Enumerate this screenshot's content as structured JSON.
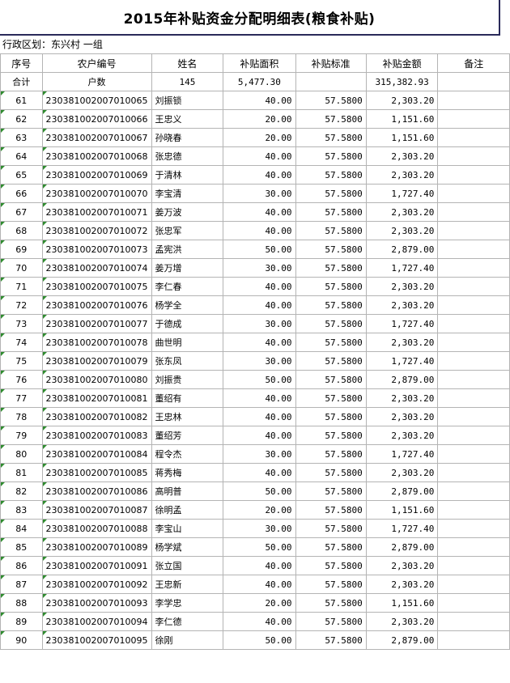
{
  "title": "2015年补贴资金分配明细表(粮食补贴)",
  "region_label": "行政区划：东兴村 一组",
  "headers": [
    "序号",
    "农户编号",
    "姓名",
    "补贴面积",
    "补贴标准",
    "补贴金额",
    "备注"
  ],
  "summary": {
    "label": "合计",
    "count_label": "户数",
    "count": "145",
    "area": "5,477.30",
    "standard": "",
    "amount": "315,382.93",
    "note": ""
  },
  "rows": [
    {
      "no": "61",
      "id": "230381002007010065",
      "name": "刘振锁",
      "area": "40.00",
      "std": "57.5800",
      "amt": "2,303.20"
    },
    {
      "no": "62",
      "id": "230381002007010066",
      "name": "王忠义",
      "area": "20.00",
      "std": "57.5800",
      "amt": "1,151.60"
    },
    {
      "no": "63",
      "id": "230381002007010067",
      "name": "孙晓春",
      "area": "20.00",
      "std": "57.5800",
      "amt": "1,151.60"
    },
    {
      "no": "64",
      "id": "230381002007010068",
      "name": "张忠德",
      "area": "40.00",
      "std": "57.5800",
      "amt": "2,303.20"
    },
    {
      "no": "65",
      "id": "230381002007010069",
      "name": "于清林",
      "area": "40.00",
      "std": "57.5800",
      "amt": "2,303.20"
    },
    {
      "no": "66",
      "id": "230381002007010070",
      "name": "李宝清",
      "area": "30.00",
      "std": "57.5800",
      "amt": "1,727.40"
    },
    {
      "no": "67",
      "id": "230381002007010071",
      "name": "姜万波",
      "area": "40.00",
      "std": "57.5800",
      "amt": "2,303.20"
    },
    {
      "no": "68",
      "id": "230381002007010072",
      "name": "张忠军",
      "area": "40.00",
      "std": "57.5800",
      "amt": "2,303.20"
    },
    {
      "no": "69",
      "id": "230381002007010073",
      "name": "孟宪洪",
      "area": "50.00",
      "std": "57.5800",
      "amt": "2,879.00"
    },
    {
      "no": "70",
      "id": "230381002007010074",
      "name": "姜万增",
      "area": "30.00",
      "std": "57.5800",
      "amt": "1,727.40"
    },
    {
      "no": "71",
      "id": "230381002007010075",
      "name": "李仁春",
      "area": "40.00",
      "std": "57.5800",
      "amt": "2,303.20"
    },
    {
      "no": "72",
      "id": "230381002007010076",
      "name": "杨学全",
      "area": "40.00",
      "std": "57.5800",
      "amt": "2,303.20"
    },
    {
      "no": "73",
      "id": "230381002007010077",
      "name": "于德成",
      "area": "30.00",
      "std": "57.5800",
      "amt": "1,727.40"
    },
    {
      "no": "74",
      "id": "230381002007010078",
      "name": "曲世明",
      "area": "40.00",
      "std": "57.5800",
      "amt": "2,303.20"
    },
    {
      "no": "75",
      "id": "230381002007010079",
      "name": "张东凤",
      "area": "30.00",
      "std": "57.5800",
      "amt": "1,727.40"
    },
    {
      "no": "76",
      "id": "230381002007010080",
      "name": "刘振贵",
      "area": "50.00",
      "std": "57.5800",
      "amt": "2,879.00"
    },
    {
      "no": "77",
      "id": "230381002007010081",
      "name": "董绍有",
      "area": "40.00",
      "std": "57.5800",
      "amt": "2,303.20"
    },
    {
      "no": "78",
      "id": "230381002007010082",
      "name": "王忠林",
      "area": "40.00",
      "std": "57.5800",
      "amt": "2,303.20"
    },
    {
      "no": "79",
      "id": "230381002007010083",
      "name": "董绍芳",
      "area": "40.00",
      "std": "57.5800",
      "amt": "2,303.20"
    },
    {
      "no": "80",
      "id": "230381002007010084",
      "name": "程令杰",
      "area": "30.00",
      "std": "57.5800",
      "amt": "1,727.40"
    },
    {
      "no": "81",
      "id": "230381002007010085",
      "name": "蒋秀梅",
      "area": "40.00",
      "std": "57.5800",
      "amt": "2,303.20"
    },
    {
      "no": "82",
      "id": "230381002007010086",
      "name": "高明普",
      "area": "50.00",
      "std": "57.5800",
      "amt": "2,879.00"
    },
    {
      "no": "83",
      "id": "230381002007010087",
      "name": "徐明孟",
      "area": "20.00",
      "std": "57.5800",
      "amt": "1,151.60"
    },
    {
      "no": "84",
      "id": "230381002007010088",
      "name": "李宝山",
      "area": "30.00",
      "std": "57.5800",
      "amt": "1,727.40"
    },
    {
      "no": "85",
      "id": "230381002007010089",
      "name": "杨学斌",
      "area": "50.00",
      "std": "57.5800",
      "amt": "2,879.00"
    },
    {
      "no": "86",
      "id": "230381002007010091",
      "name": "张立国",
      "area": "40.00",
      "std": "57.5800",
      "amt": "2,303.20"
    },
    {
      "no": "87",
      "id": "230381002007010092",
      "name": "王忠新",
      "area": "40.00",
      "std": "57.5800",
      "amt": "2,303.20"
    },
    {
      "no": "88",
      "id": "230381002007010093",
      "name": "李学忠",
      "area": "20.00",
      "std": "57.5800",
      "amt": "1,151.60"
    },
    {
      "no": "89",
      "id": "230381002007010094",
      "name": "李仁德",
      "area": "40.00",
      "std": "57.5800",
      "amt": "2,303.20"
    },
    {
      "no": "90",
      "id": "230381002007010095",
      "name": "徐刚",
      "area": "50.00",
      "std": "57.5800",
      "amt": "2,879.00"
    }
  ]
}
